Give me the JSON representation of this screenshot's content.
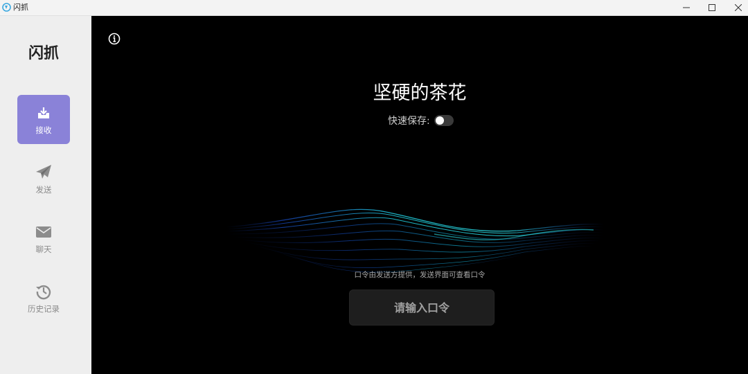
{
  "window": {
    "title": "闪抓",
    "icon": "app-logo-icon",
    "controls": [
      "minimize-icon",
      "maximize-icon",
      "close-icon"
    ]
  },
  "sidebar": {
    "brand": "闪抓",
    "items": [
      {
        "label": "接收",
        "icon": "download-tray-icon",
        "active": true
      },
      {
        "label": "发送",
        "icon": "paper-plane-icon",
        "active": false
      },
      {
        "label": "聊天",
        "icon": "mail-icon",
        "active": false
      },
      {
        "label": "历史记录",
        "icon": "history-icon",
        "active": false
      }
    ]
  },
  "main": {
    "info_icon": "info-icon",
    "device_name": "坚硬的茶花",
    "quick_save_label": "快速保存:",
    "quick_save_enabled": false,
    "hint": "口令由发送方提供，发送界面可查看口令",
    "code_placeholder": "请输入口令"
  },
  "colors": {
    "accent": "#8a82d8",
    "sidebar_bg": "#eeeeee",
    "main_bg": "#000000",
    "wave_cyan": "#1fd6d6",
    "wave_blue": "#1a5ad8"
  }
}
